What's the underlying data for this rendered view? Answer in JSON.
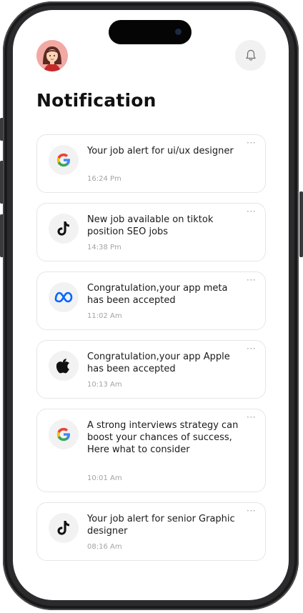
{
  "header": {
    "title": "Notification",
    "avatar_icon": "user-avatar",
    "bell_icon": "bell-icon"
  },
  "notifications": [
    {
      "company": "Google",
      "logo_icon": "google-icon",
      "message": "Your job alert for ui/ux designer",
      "time": "16:24 Pm",
      "more_label": "···"
    },
    {
      "company": "TikTok",
      "logo_icon": "tiktok-icon",
      "message": "New job available on tiktok position SEO jobs",
      "time": "14:38 Pm",
      "more_label": "···"
    },
    {
      "company": "Meta",
      "logo_icon": "meta-icon",
      "message": "Congratulation,your app meta has been accepted",
      "time": "11:02 Am",
      "more_label": "···"
    },
    {
      "company": "Apple",
      "logo_icon": "apple-icon",
      "message": "Congratulation,your app Apple  has been accepted",
      "time": "10:13 Am",
      "more_label": "···"
    },
    {
      "company": "Google",
      "logo_icon": "google-icon",
      "message": "A strong interviews strategy can boost your chances of success, Here what to consider",
      "time": "10:01 Am",
      "more_label": "···"
    },
    {
      "company": "TikTok",
      "logo_icon": "tiktok-icon",
      "message": "Your job alert for senior Graphic designer",
      "time": "08:16 Am",
      "more_label": "···"
    }
  ],
  "colors": {
    "text": "#1a1a1a",
    "muted": "#a3a3a6",
    "card_border": "#e6e6e8",
    "logo_bg": "#f2f2f3",
    "avatar_bg": "#f2a9a4",
    "google_blue": "#4285F4",
    "google_red": "#EA4335",
    "google_yellow": "#FBBC05",
    "google_green": "#34A853",
    "meta_blue": "#0866FF"
  }
}
